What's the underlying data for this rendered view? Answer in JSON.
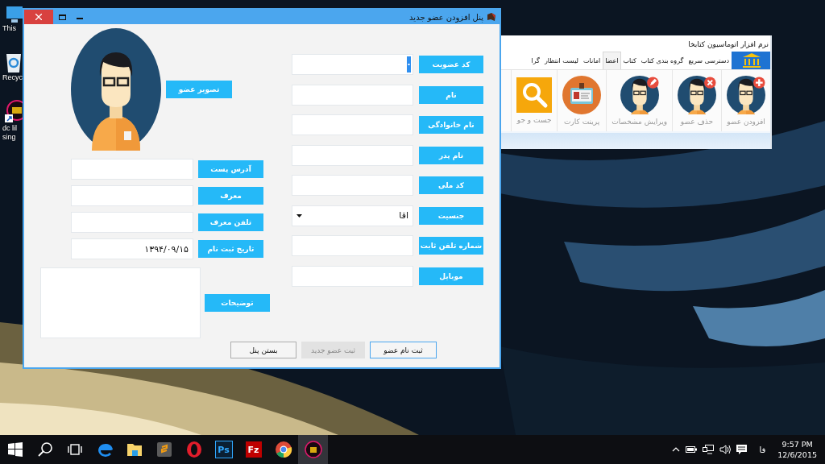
{
  "desktop_icons": [
    {
      "kind": "computer",
      "lines": [
        "This"
      ]
    },
    {
      "kind": "recycle",
      "lines": [
        "Recyc"
      ]
    },
    {
      "kind": "app",
      "lines": [
        "dc lil",
        "sing"
      ]
    }
  ],
  "back_window": {
    "title": "نرم افزار اتوماسیون کتابخا",
    "tabs": [
      {
        "label": "دسترسی سریع",
        "selected": false
      },
      {
        "label": "گروه بندی کتاب",
        "selected": false
      },
      {
        "label": "کتاب",
        "selected": false
      },
      {
        "label": "اعضا",
        "selected": true
      },
      {
        "label": "امانات",
        "selected": false
      },
      {
        "label": "لیست انتظار",
        "selected": false
      },
      {
        "label": "گرا",
        "selected": false
      }
    ],
    "ribbon_buttons": [
      {
        "label": "افزودن عضو",
        "kind": "add"
      },
      {
        "label": "حذف عضو",
        "kind": "delete"
      },
      {
        "label": "ویرایش مشخصات",
        "kind": "edit"
      },
      {
        "label": "پرینت کارت",
        "kind": "card"
      },
      {
        "label": "جست و جو",
        "kind": "search"
      }
    ]
  },
  "window": {
    "title": "پنل افزودن عضو جدید",
    "photo_button": "تصویر عضو",
    "right_fields": [
      {
        "label": "کد عضویت",
        "kind": "combo"
      },
      {
        "label": "نام",
        "kind": "text"
      },
      {
        "label": "نام خانوادگی",
        "kind": "text"
      },
      {
        "label": "نام پدر",
        "kind": "text"
      },
      {
        "label": "کد ملی",
        "kind": "text"
      },
      {
        "label": "جنسیت",
        "kind": "select",
        "value": "اقا"
      },
      {
        "label": "شماره تلفن ثابت",
        "kind": "text"
      },
      {
        "label": "موبایل",
        "kind": "text"
      }
    ],
    "left_fields": [
      {
        "label": "آدرس پست"
      },
      {
        "label": "معرف"
      },
      {
        "label": "تلفن معرف"
      },
      {
        "label": "تاریخ ثبت نام",
        "value": "۱۳۹۴/۰۹/۱۵"
      }
    ],
    "notes_button": "توضیحات",
    "buttons": [
      {
        "label": "ثبت نام عضو",
        "disabled": false,
        "focused": true
      },
      {
        "label": "ثبت عضو جدید",
        "disabled": true,
        "focused": false
      },
      {
        "label": "بستن پنل",
        "disabled": false,
        "focused": false
      }
    ]
  },
  "taskbar": {
    "apps": [
      {
        "selected": true
      },
      {
        "selected": false
      },
      {
        "selected": false,
        "glyph": "Fz"
      },
      {
        "selected": false,
        "glyph": "Ps"
      },
      {
        "selected": false
      },
      {
        "selected": false
      },
      {
        "selected": false
      },
      {
        "selected": false
      },
      {
        "selected": false
      },
      {
        "selected": false
      },
      {
        "selected": false
      }
    ]
  },
  "tray": {
    "language": "فا",
    "time": "9:57 PM",
    "date": "12/6/2015"
  }
}
